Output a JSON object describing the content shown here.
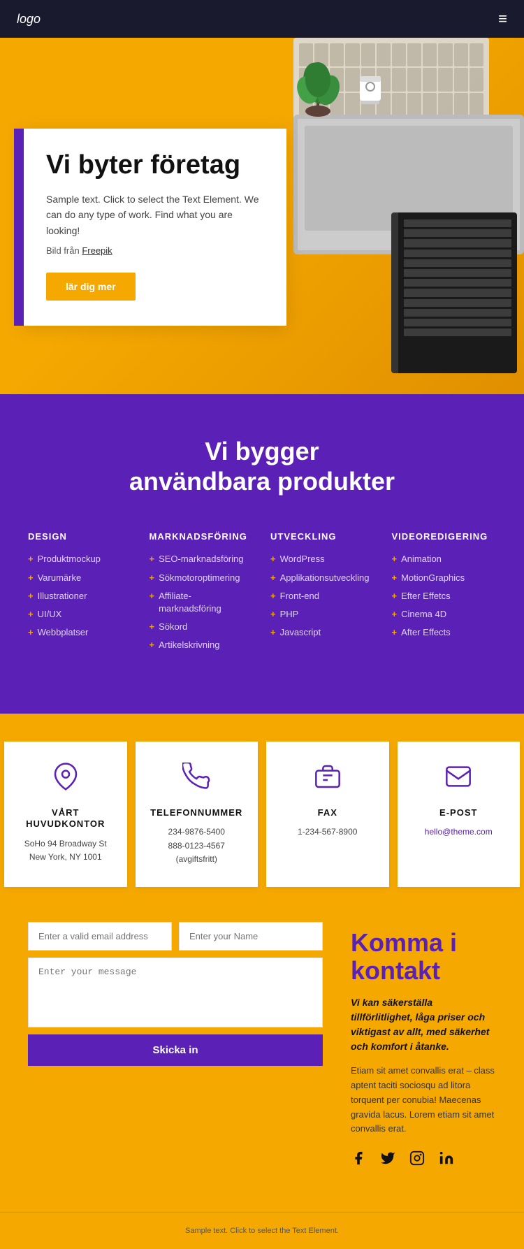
{
  "nav": {
    "logo": "logo",
    "menu_icon": "≡"
  },
  "hero": {
    "title": "Vi byter företag",
    "text": "Sample text. Click to select the Text Element. We can do any type of work. Find what you are looking!",
    "source_label": "Bild från",
    "source_link": "Freepik",
    "btn_label": "lär dig mer"
  },
  "services": {
    "title_line1": "Vi bygger",
    "title_line2": "användbara produkter",
    "columns": [
      {
        "heading": "DESIGN",
        "items": [
          "Produktmockup",
          "Varumärke",
          "Illustrationer",
          "UI/UX",
          "Webbplatser"
        ]
      },
      {
        "heading": "MARKNADSFÖRING",
        "items": [
          "SEO-marknadsföring",
          "Sökmotoroptimering",
          "Affiliate-marknadsföring",
          "Sökord",
          "Artikelskrivning"
        ]
      },
      {
        "heading": "UTVECKLING",
        "items": [
          "WordPress",
          "Applikationsutveckling",
          "Front-end",
          "PHP",
          "Javascript"
        ]
      },
      {
        "heading": "VIDEOREDIGERING",
        "items": [
          "Animation",
          "MotionGraphics",
          "Efter Effetcs",
          "Cinema 4D",
          "After Effects"
        ]
      }
    ]
  },
  "contact_cards": [
    {
      "id": "location",
      "heading": "VÅRT HUVUDKONTOR",
      "text": "SoHo 94 Broadway St New York, NY 1001"
    },
    {
      "id": "phone",
      "heading": "TELEFONNUMMER",
      "line1": "234-9876-5400",
      "line2": "888-0123-4567 (avgiftsfritt)"
    },
    {
      "id": "fax",
      "heading": "FAX",
      "text": "1-234-567-8900"
    },
    {
      "id": "email",
      "heading": "E-POST",
      "email": "hello@theme.com"
    }
  ],
  "contact_form": {
    "email_placeholder": "Enter a valid email address",
    "name_placeholder": "Enter your Name",
    "message_placeholder": "Enter your message",
    "submit_label": "Skicka in"
  },
  "contact_info": {
    "heading": "Komma i kontakt",
    "italic_text": "Vi kan säkerställa tillförlitlighet, låga priser och viktigast av allt, med säkerhet och komfort i åtanke.",
    "body_text": "Etiam sit amet convallis erat – class aptent taciti sociosqu ad litora torquent per conubia! Maecenas gravida lacus. Lorem etiam sit amet convallis erat.",
    "social": [
      "f",
      "t",
      "insta",
      "in"
    ]
  },
  "footer": {
    "text": "Sample text. Click to select the Text Element."
  }
}
